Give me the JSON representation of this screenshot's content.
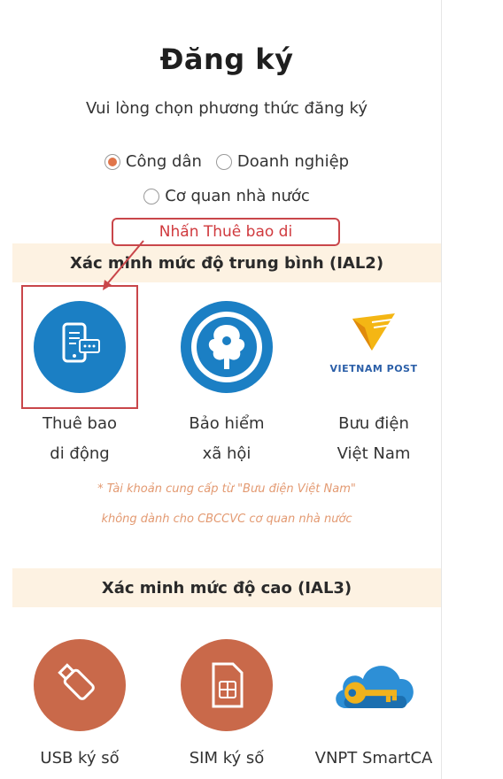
{
  "page": {
    "title": "Đăng ký",
    "subtitle": "Vui lòng chọn phương thức đăng ký"
  },
  "options": {
    "citizen": "Công dân",
    "business": "Doanh nghiệp",
    "agency": "Cơ quan nhà nước",
    "selected": "citizen"
  },
  "annotation": {
    "text": "Nhấn Thuê bao di",
    "color": "#c9464a"
  },
  "ial2": {
    "heading": "Xác minh mức độ trung bình (IAL2)",
    "items": [
      {
        "line1": "Thuê bao",
        "line2": "di động",
        "icon": "mobile-subscriber-icon"
      },
      {
        "line1": "Bảo hiểm",
        "line2": "xã hội",
        "icon": "social-insurance-logo"
      },
      {
        "line1": "Bưu điện",
        "line2": "Việt Nam",
        "icon": "vietnam-post-logo"
      }
    ],
    "logo_text": "VIETNAM POST",
    "note_line1": "* Tài khoản cung cấp từ \"Bưu điện Việt Nam\"",
    "note_line2": "không dành cho CBCCVC cơ quan nhà nước"
  },
  "ial3": {
    "heading": "Xác minh mức độ cao (IAL3)",
    "items": [
      {
        "label": "USB ký số",
        "icon": "usb-token-icon"
      },
      {
        "label": "SIM ký số",
        "icon": "sim-card-icon"
      },
      {
        "label": "VNPT SmartCA",
        "icon": "cloud-key-icon"
      }
    ]
  },
  "colors": {
    "accent": "#e0754a",
    "band": "#fdf2e2",
    "blue": "#1b7fc4",
    "orange": "#c9694a"
  }
}
